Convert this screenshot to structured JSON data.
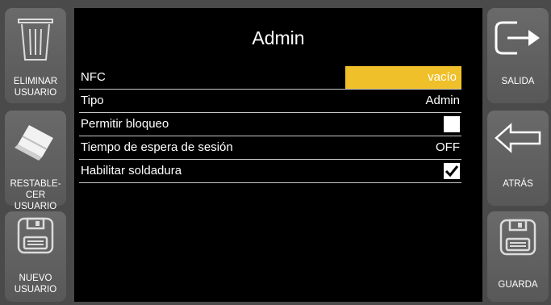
{
  "left_buttons": {
    "eliminar": "ELIMINAR\nUSUARIO",
    "restablecer": "RESTABLE-\nCER USUARIO",
    "nuevo": "NUEVO\nUSUARIO"
  },
  "right_buttons": {
    "salida": "SALIDA",
    "atras": "ATRÁS",
    "guarda": "GUARDA"
  },
  "panel": {
    "title": "Admin",
    "rows": [
      {
        "label": "NFC",
        "value": "vacío",
        "highlight_color": "#f0c02a"
      },
      {
        "label": "Tipo",
        "value": "Admin"
      },
      {
        "label": "Permitir bloqueo",
        "checked": false
      },
      {
        "label": "Tiempo de espera de sesión",
        "value": "OFF"
      },
      {
        "label": "Habilitar soldadura",
        "checked": true
      }
    ]
  },
  "icons": {
    "eliminar": "trash-icon",
    "restablecer": "eraser-icon",
    "nuevo": "floppy-disk-icon",
    "salida": "exit-arrow-icon",
    "atras": "back-arrow-icon",
    "guarda": "floppy-disk-icon"
  }
}
